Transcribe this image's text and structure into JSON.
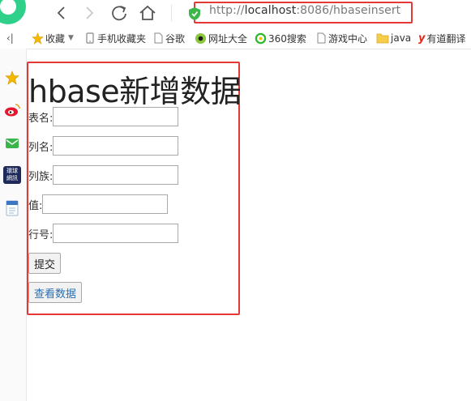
{
  "browser": {
    "url_prefix": "http://",
    "url_host": "localhost",
    "url_rest": ":8086/hbaseinsert"
  },
  "bookmarks": {
    "collapse_label": "‹|",
    "items": [
      {
        "label": "收藏",
        "icon": "star-icon"
      },
      {
        "label": "手机收藏夹",
        "icon": "folder-icon"
      },
      {
        "label": "谷歌",
        "icon": "page-icon"
      },
      {
        "label": "网址大全",
        "icon": "site-nav-icon"
      },
      {
        "label": "360搜索",
        "icon": "360-search-icon"
      },
      {
        "label": "游戏中心",
        "icon": "page-icon"
      },
      {
        "label": "java",
        "icon": "folder-icon"
      },
      {
        "label": "有道翻译",
        "icon": "youdao-icon"
      }
    ]
  },
  "sidebar_icons": [
    "star-icon",
    "weibo-icon",
    "mail-icon",
    "huanqiu-icon",
    "word-doc-icon"
  ],
  "huanqiu_text": "環球\n網訊",
  "page": {
    "title": "hbase新增数据",
    "fields": [
      {
        "label": "表名:",
        "value": ""
      },
      {
        "label": "列名:",
        "value": ""
      },
      {
        "label": "列族:",
        "value": ""
      },
      {
        "label": "值:",
        "value": ""
      },
      {
        "label": "行号:",
        "value": ""
      }
    ],
    "submit_label": "提交",
    "view_label": "查看数据"
  },
  "colors": {
    "highlight": "#e53935",
    "logo": "#2fd18a",
    "link": "#2a6fb0"
  }
}
